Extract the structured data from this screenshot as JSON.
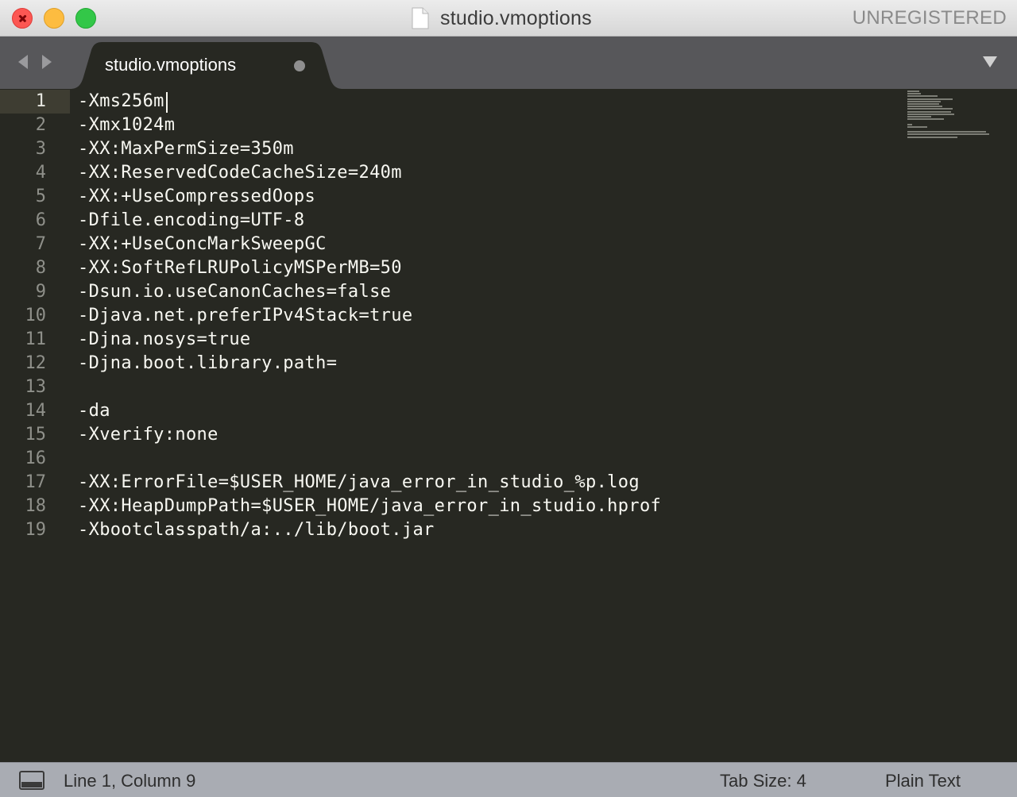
{
  "window": {
    "title": "studio.vmoptions",
    "license_label": "UNREGISTERED"
  },
  "tabs": [
    {
      "label": "studio.vmoptions",
      "dirty": true
    }
  ],
  "editor": {
    "active_line": 1,
    "lines": [
      "-Xms256m",
      "-Xmx1024m",
      "-XX:MaxPermSize=350m",
      "-XX:ReservedCodeCacheSize=240m",
      "-XX:+UseCompressedOops",
      "-Dfile.encoding=UTF-8",
      "-XX:+UseConcMarkSweepGC",
      "-XX:SoftRefLRUPolicyMSPerMB=50",
      "-Dsun.io.useCanonCaches=false",
      "-Djava.net.preferIPv4Stack=true",
      "-Djna.nosys=true",
      "-Djna.boot.library.path=",
      "",
      "-da",
      "-Xverify:none",
      "",
      "-XX:ErrorFile=$USER_HOME/java_error_in_studio_%p.log",
      "-XX:HeapDumpPath=$USER_HOME/java_error_in_studio.hprof",
      "-Xbootclasspath/a:../lib/boot.jar"
    ]
  },
  "status": {
    "position": "Line 1, Column 9",
    "tab_size": "Tab Size: 4",
    "syntax": "Plain Text"
  },
  "colors": {
    "editor_bg": "#272822",
    "text": "#f8f8f2",
    "gutter_text": "#8f908a",
    "tabbar_bg": "#57575a",
    "statusbar_bg": "#a9acb3"
  }
}
